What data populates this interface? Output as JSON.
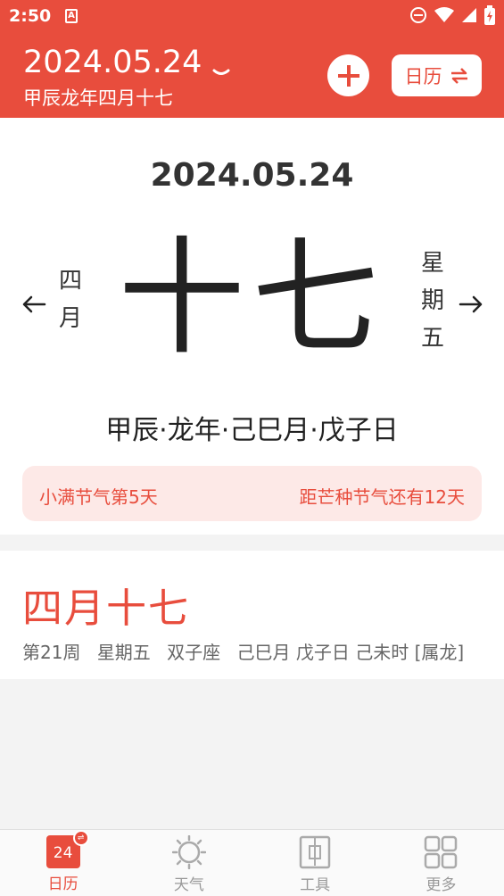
{
  "status_bar": {
    "time": "2:50",
    "notification_icon": "A"
  },
  "header": {
    "date": "2024.05.24",
    "lunar_date": "甲辰龙年四月十七",
    "toggle_label": "日历"
  },
  "main": {
    "date": "2024.05.24",
    "month_vertical": "四月",
    "day_large": "十七",
    "weekday_vertical": "星期五",
    "ganzhi": "甲辰·龙年·己巳月·戊子日",
    "solar_term_current": "小满节气第5天",
    "solar_term_next": "距芒种节气还有12天"
  },
  "lunar_card": {
    "title": "四月十七",
    "week": "第21周",
    "weekday": "星期五",
    "zodiac_sign": "双子座",
    "details": "己巳月 戊子日 己未时 [属龙]"
  },
  "bottom_nav": {
    "items": [
      {
        "label": "日历",
        "icon": "calendar-icon",
        "badge": "24"
      },
      {
        "label": "天气",
        "icon": "sun-icon"
      },
      {
        "label": "工具",
        "icon": "toolbox-icon"
      },
      {
        "label": "更多",
        "icon": "grid-icon"
      }
    ]
  },
  "colors": {
    "accent": "#e84d3d",
    "accent_light": "#fde9e7",
    "background": "#f3f3f3"
  }
}
